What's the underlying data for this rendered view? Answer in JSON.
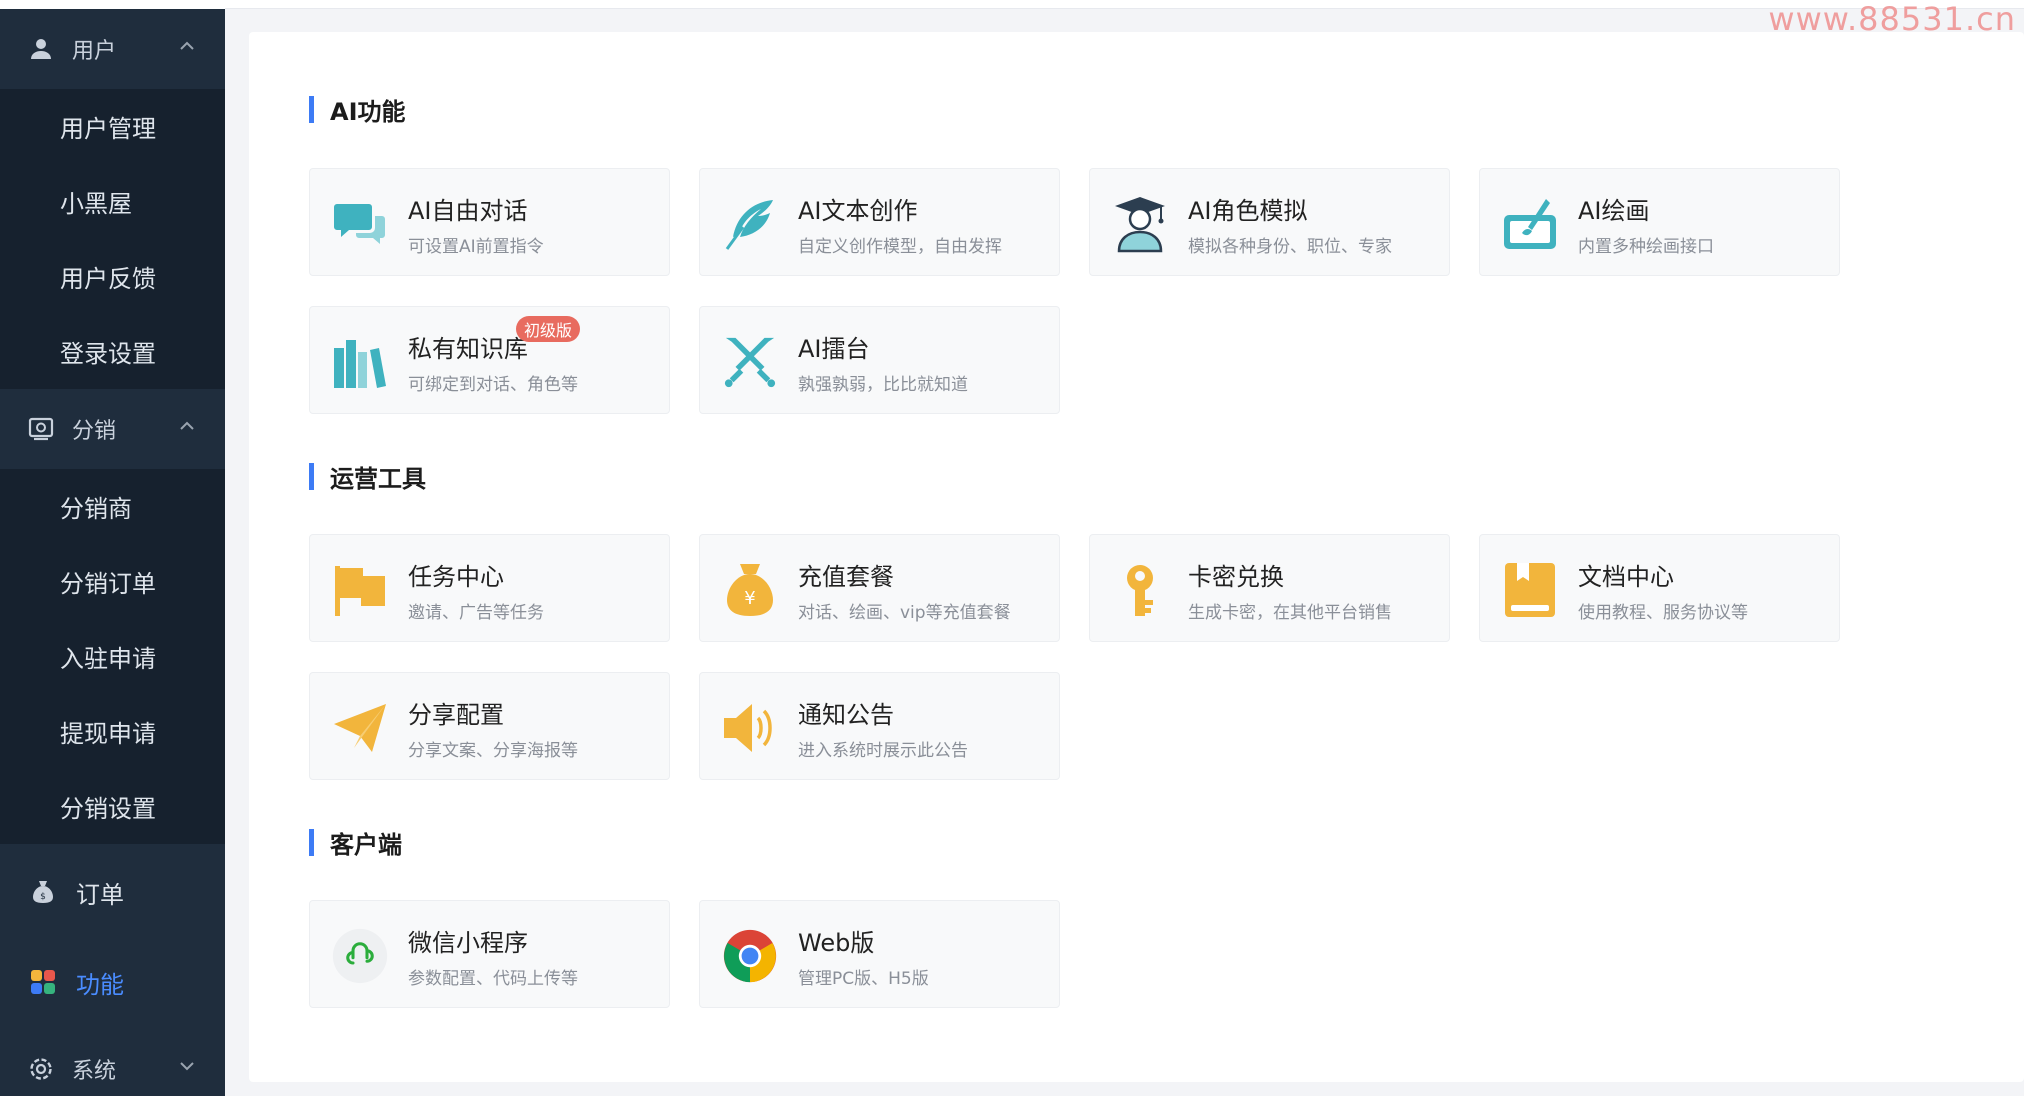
{
  "sidebar": {
    "groups": [
      {
        "label": "用户",
        "items": [
          "用户管理",
          "小黑屋",
          "用户反馈",
          "登录设置"
        ]
      },
      {
        "label": "分销",
        "items": [
          "分销商",
          "分销订单",
          "入驻申请",
          "提现申请",
          "分销设置"
        ]
      }
    ],
    "order_label": "订单",
    "feature_label": "功能",
    "system_label": "系统"
  },
  "watermark": "www.88531.cn",
  "sections": {
    "ai": {
      "title": "AI功能",
      "cards": [
        {
          "title": "AI自由对话",
          "desc": "可设置AI前置指令"
        },
        {
          "title": "AI文本创作",
          "desc": "自定义创作模型，自由发挥"
        },
        {
          "title": "AI角色模拟",
          "desc": "模拟各种身份、职位、专家"
        },
        {
          "title": "AI绘画",
          "desc": "内置多种绘画接口"
        },
        {
          "title": "私有知识库",
          "desc": "可绑定到对话、角色等",
          "badge": "初级版"
        },
        {
          "title": "AI擂台",
          "desc": "孰强孰弱，比比就知道"
        }
      ]
    },
    "ops": {
      "title": "运营工具",
      "cards": [
        {
          "title": "任务中心",
          "desc": "邀请、广告等任务"
        },
        {
          "title": "充值套餐",
          "desc": "对话、绘画、vip等充值套餐"
        },
        {
          "title": "卡密兑换",
          "desc": "生成卡密，在其他平台销售"
        },
        {
          "title": "文档中心",
          "desc": "使用教程、服务协议等"
        },
        {
          "title": "分享配置",
          "desc": "分享文案、分享海报等"
        },
        {
          "title": "通知公告",
          "desc": "进入系统时展示此公告"
        }
      ]
    },
    "client": {
      "title": "客户端",
      "cards": [
        {
          "title": "微信小程序",
          "desc": "参数配置、代码上传等"
        },
        {
          "title": "Web版",
          "desc": "管理PC版、H5版"
        }
      ]
    }
  },
  "colors": {
    "sidebar_bg": "#1f2d3d",
    "submenu_bg": "#16212e",
    "accent": "#3d7bf5",
    "badge": "#e86b5f"
  }
}
